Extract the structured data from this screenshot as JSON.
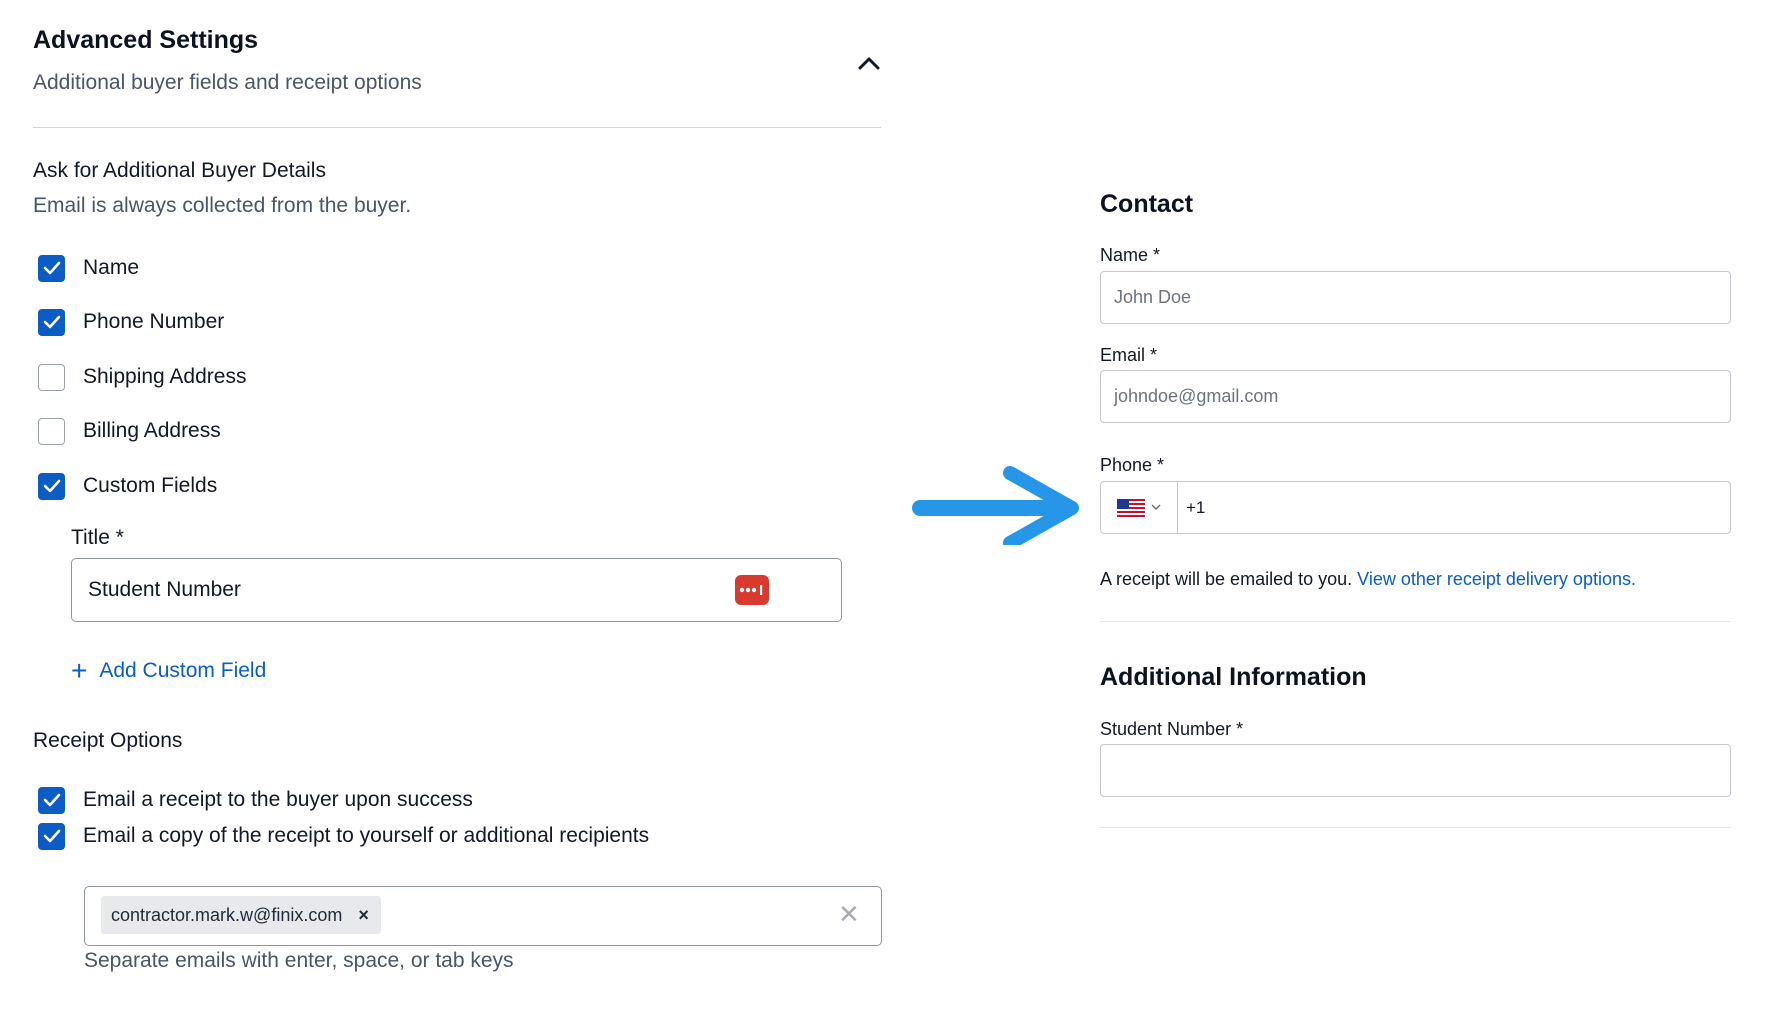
{
  "advanced": {
    "title": "Advanced Settings",
    "subtitle": "Additional buyer fields and receipt options"
  },
  "buyer_details": {
    "title": "Ask for Additional Buyer Details",
    "subtitle": "Email is always collected from the buyer.",
    "options": [
      {
        "label": "Name",
        "checked": true
      },
      {
        "label": "Phone Number",
        "checked": true
      },
      {
        "label": "Shipping Address",
        "checked": false
      },
      {
        "label": "Billing Address",
        "checked": false
      },
      {
        "label": "Custom Fields",
        "checked": true
      }
    ]
  },
  "custom_field": {
    "title_label": "Title *",
    "title_value": "Student Number",
    "add_label": "Add Custom Field"
  },
  "receipt_options": {
    "title": "Receipt Options",
    "options": [
      {
        "label": "Email a receipt to the buyer upon success",
        "checked": true
      },
      {
        "label": "Email a copy of the receipt to yourself or additional recipients",
        "checked": true
      }
    ],
    "recipient_chip": "contractor.mark.w@finix.com",
    "chip_remove": "×",
    "clear": "✕",
    "hint": "Separate emails with enter, space, or tab keys"
  },
  "preview": {
    "contact_heading": "Contact",
    "name_label": "Name *",
    "name_placeholder": "John Doe",
    "email_label": "Email *",
    "email_placeholder": "johndoe@gmail.com",
    "phone_label": "Phone *",
    "phone_code": "+1",
    "receipt_text": "A receipt will be emailed to you.",
    "receipt_link": "View other receipt delivery options.",
    "additional_heading": "Additional Information",
    "student_label": "Student Number *"
  },
  "colors": {
    "accent": "#0b5cc4",
    "arrow": "#2596e8",
    "password_icon": "#d93a2f"
  }
}
